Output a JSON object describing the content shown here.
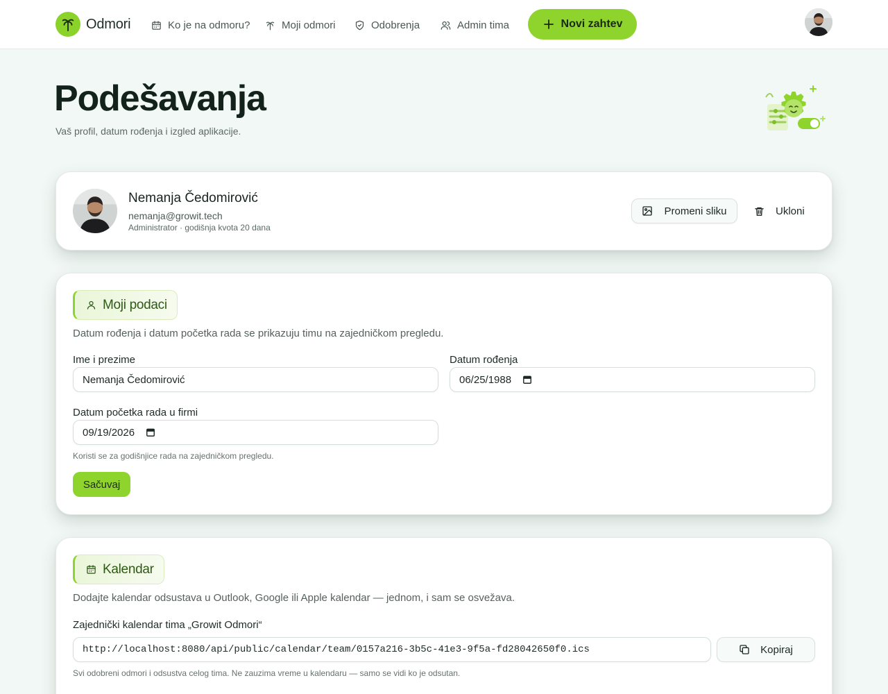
{
  "nav": {
    "brand": "Odmori",
    "items": [
      {
        "label": "Ko je na odmoru?",
        "icon": "calendar-icon"
      },
      {
        "label": "Moji odmori",
        "icon": "palm-icon"
      },
      {
        "label": "Odobrenja",
        "icon": "shield-check-icon"
      },
      {
        "label": "Admin tima",
        "icon": "users-icon"
      }
    ],
    "new_request": "Novi zahtev"
  },
  "header": {
    "title": "Podešavanja",
    "subtitle": "Vaš profil, datum rođenja i izgled aplikacije."
  },
  "profile": {
    "name": "Nemanja Čedomirović",
    "email": "nemanja@growit.tech",
    "role": "Administrator · godišnja kvota 20 dana",
    "change_photo": "Promeni sliku",
    "remove": "Ukloni"
  },
  "my_data": {
    "heading": "Moji podaci",
    "description": "Datum rođenja i datum početka rada se prikazuju timu na zajedničkom pregledu.",
    "name_label": "Ime i prezime",
    "name_value": "Nemanja Čedomirović",
    "birth_label": "Datum rođenja",
    "birth_value": "06/25/1988",
    "start_label": "Datum početka rada u firmi",
    "start_value": "09/19/2026",
    "start_hint": "Koristi se za godišnjice rada na zajedničkom pregledu.",
    "save": "Sačuvaj"
  },
  "calendar": {
    "heading": "Kalendar",
    "description": "Dodajte kalendar odsustava u Outlook, Google ili Apple kalendar — jednom, i sam se osvežava.",
    "feed_label": "Zajednički kalendar tima „Growit Odmori“",
    "feed_url": "http://localhost:8080/api/public/calendar/team/0157a216-3b5c-41e3-9f5a-fd28042650f0.ics",
    "copy": "Kopiraj",
    "feed_hint": "Svi odobreni odmori i odsustva celog tima. Ne zauzima vreme u kalendaru — samo se vidi ko je odsutan."
  },
  "colors": {
    "accent": "#8fd42c",
    "background": "#f2f8f6"
  }
}
